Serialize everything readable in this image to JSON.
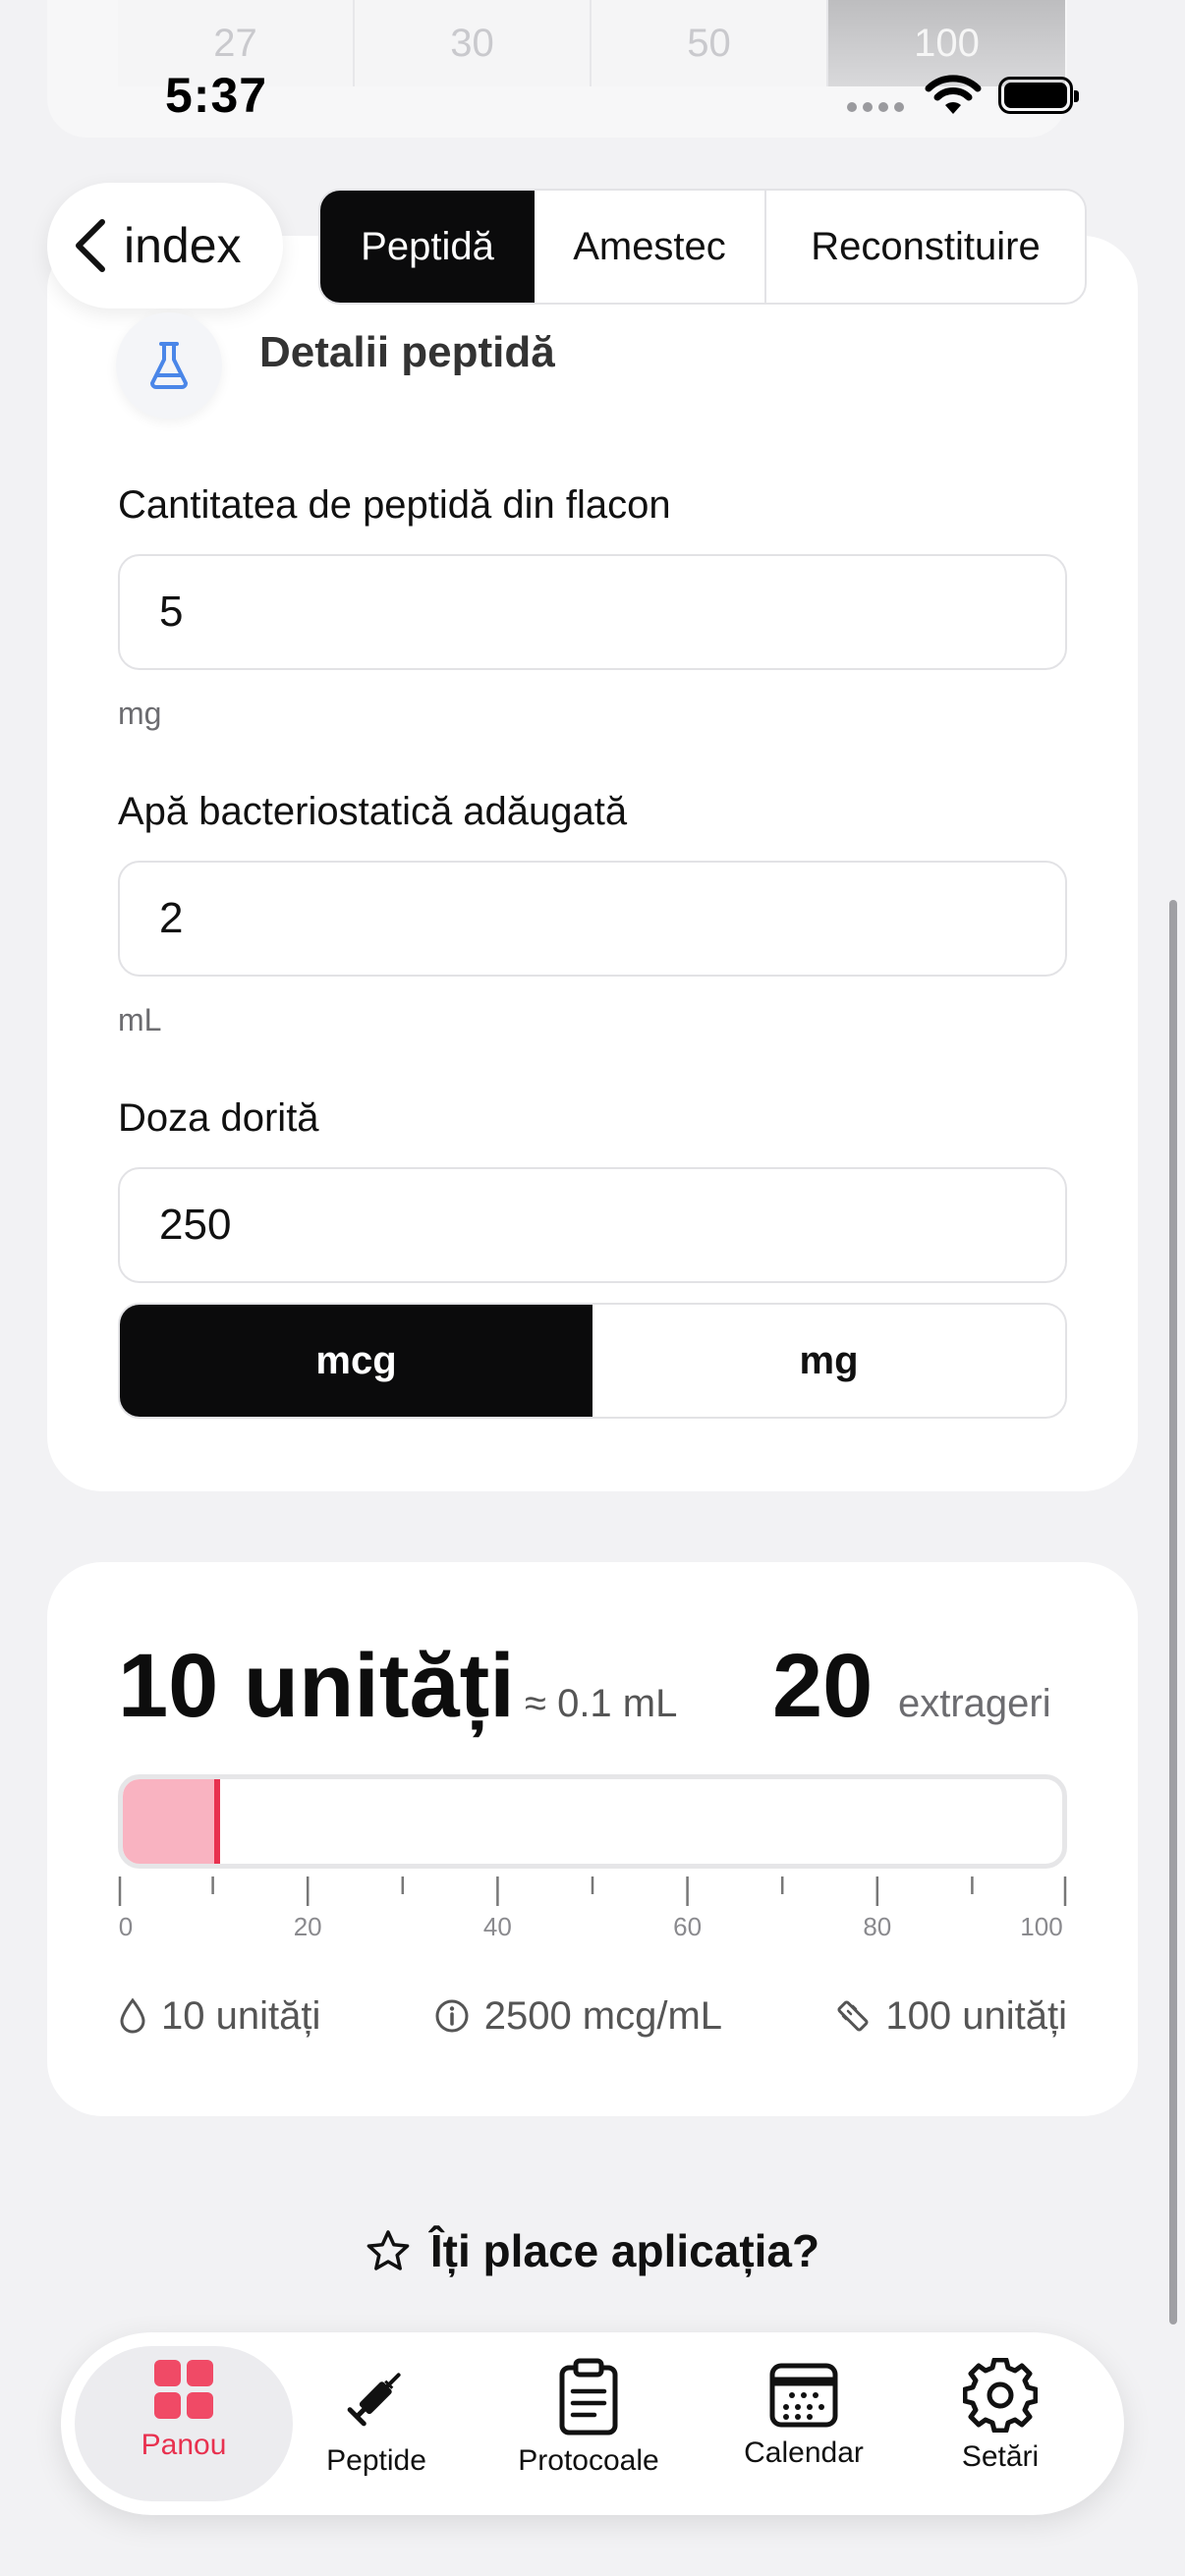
{
  "syringe_sizes": {
    "options": [
      "27",
      "30",
      "50",
      "100"
    ],
    "selected": "100"
  },
  "status_bar": {
    "time": "5:37"
  },
  "nav": {
    "back_label": "index"
  },
  "mode_tabs": [
    {
      "label": "Peptidă",
      "active": true
    },
    {
      "label": "Amestec",
      "active": false
    },
    {
      "label": "Reconstituire",
      "active": false
    }
  ],
  "peptide_card": {
    "title": "Detalii peptidă",
    "icon": "flask-icon",
    "vial_amount": {
      "label": "Cantitatea de peptidă din flacon",
      "value": "5",
      "unit": "mg"
    },
    "bac_water": {
      "label": "Apă bacteriostatică adăugată",
      "value": "2",
      "unit": "mL"
    },
    "desired_dose": {
      "label": "Doza dorită",
      "value": "250"
    },
    "dose_unit_toggle": {
      "options": [
        "mcg",
        "mg"
      ],
      "selected": "mcg"
    }
  },
  "result_card": {
    "units_text": "10 unități",
    "volume_text": "≈ 0.1 mL",
    "draws_count": "20",
    "draws_label": "extrageri",
    "syringe_fill": {
      "value": 10,
      "max": 100
    },
    "scale_labels": [
      "0",
      "20",
      "40",
      "60",
      "80",
      "100"
    ],
    "stats": [
      {
        "icon": "droplet-icon",
        "text": "10 unități"
      },
      {
        "icon": "info-icon",
        "text": "2500 mcg/mL"
      },
      {
        "icon": "ruler-icon",
        "text": "100 unități"
      }
    ]
  },
  "rate_prompt": {
    "text": "Îți place aplicația?",
    "icon": "star-icon"
  },
  "tab_bar": [
    {
      "label": "Panou",
      "icon": "dashboard-grid-icon",
      "active": true
    },
    {
      "label": "Peptide",
      "icon": "syringe-icon",
      "active": false
    },
    {
      "label": "Protocoale",
      "icon": "clipboard-icon",
      "active": false
    },
    {
      "label": "Calendar",
      "icon": "calendar-icon",
      "active": false
    },
    {
      "label": "Setări",
      "icon": "gear-icon",
      "active": false
    }
  ],
  "colors": {
    "accent": "#e8314f",
    "fill_pink": "#f9b3c1",
    "dark": "#0b0b0c"
  }
}
